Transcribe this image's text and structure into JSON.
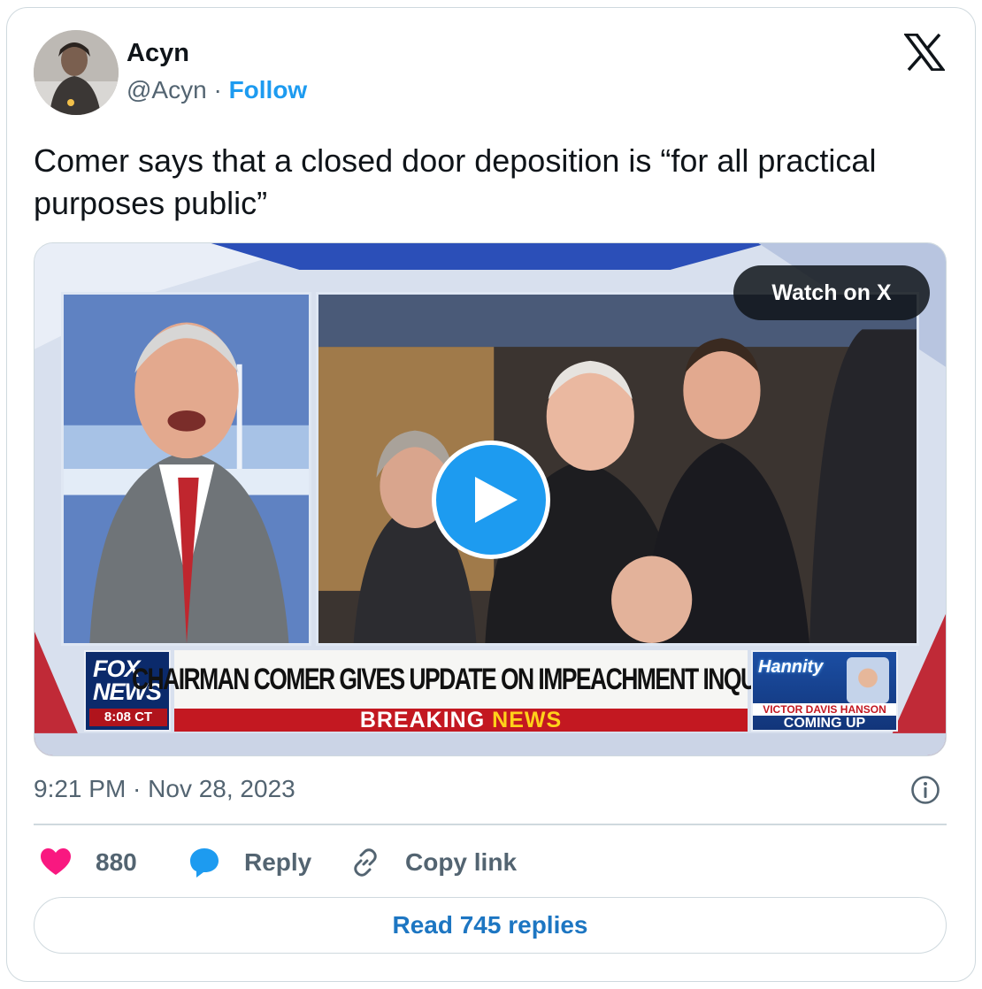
{
  "author": {
    "name": "Acyn",
    "handle": "@Acyn",
    "separator": "·",
    "follow_label": "Follow"
  },
  "tweet": {
    "text": "Comer says that a closed door deposition is “for all practical purposes public”",
    "timestamp": "9:21 PM · Nov 28, 2023"
  },
  "media": {
    "watch_label": "Watch on X",
    "broadcast": {
      "network_logo_text": "FOX NEWS",
      "network_time": "8:08 CT",
      "headline": "CHAIRMAN COMER GIVES UPDATE ON IMPEACHMENT INQUIRY",
      "breaking_word_1": "BREAKING",
      "breaking_word_2": "NEWS",
      "promo_show": "Hannity",
      "promo_name": "VICTOR DAVIS HANSON",
      "promo_sub": "COMING UP"
    }
  },
  "actions": {
    "like_count": "880",
    "reply_label": "Reply",
    "copy_label": "Copy link"
  },
  "footer": {
    "read_replies_label": "Read 745 replies"
  },
  "colors": {
    "accent": "#1d9bf0",
    "like": "#f91880",
    "muted": "#536471",
    "text": "#0f1419"
  },
  "icons": {
    "logo": "x-logo-icon",
    "like": "heart-icon",
    "reply": "speech-bubble-icon",
    "copy": "link-icon",
    "info": "info-icon",
    "play": "play-icon"
  }
}
